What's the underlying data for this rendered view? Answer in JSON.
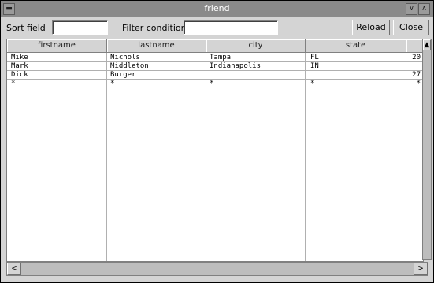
{
  "window": {
    "title": "friend"
  },
  "toolbar": {
    "sort_label": "Sort field",
    "sort_value": "",
    "filter_label": "Filter conditions",
    "filter_value": "",
    "reload_label": "Reload",
    "close_label": "Close"
  },
  "table": {
    "columns": [
      "firstname",
      "lastname",
      "city",
      "state"
    ],
    "rows": [
      [
        "Mike",
        "Nichols",
        "Tampa",
        "FL",
        "20"
      ],
      [
        "Mark",
        "Middleton",
        "Indianapolis",
        "IN",
        ""
      ],
      [
        "Dick",
        "Burger",
        "",
        "",
        "27"
      ],
      [
        "*",
        "*",
        "*",
        "*",
        "*"
      ]
    ]
  },
  "scroll": {
    "up": "▲",
    "left": "<",
    "right": ">"
  }
}
